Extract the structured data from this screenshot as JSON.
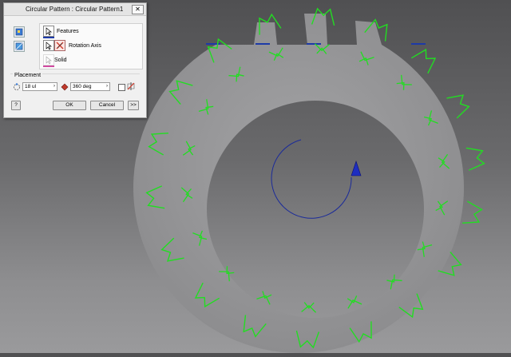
{
  "dialog": {
    "title": "Circular Pattern : Circular Pattern1",
    "close_label": "✕",
    "features_label": "Features",
    "rotation_axis_label": "Rotation Axis",
    "solid_label": "Solid",
    "placement_label": "Placement",
    "count_value": "18 ul",
    "angle_value": "360 deg",
    "ok_label": "OK",
    "cancel_label": "Cancel",
    "more_label": ">>",
    "help_label": "?"
  },
  "colors": {
    "gear": "#9b9b9d",
    "preview": "#22dd22",
    "axis": "#1a2a9a"
  },
  "viewport": {
    "pattern_count": 18
  }
}
